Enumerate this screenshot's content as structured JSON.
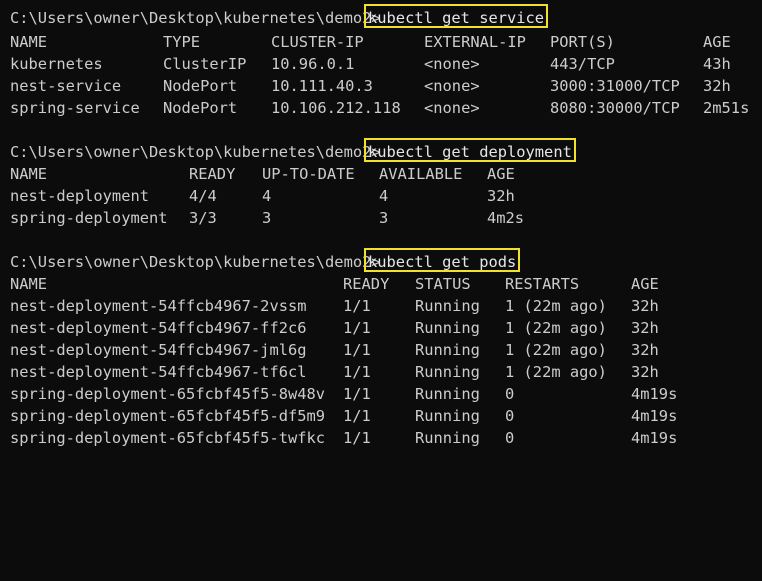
{
  "terminal": {
    "blocks": [
      {
        "prompt": "C:\\Users\\owner\\Desktop\\kubernetes\\demo2>",
        "command": "kubectl get service",
        "headers": [
          "NAME",
          "TYPE",
          "CLUSTER-IP",
          "EXTERNAL-IP",
          "PORT(S)",
          "AGE"
        ],
        "rows": [
          [
            "kubernetes",
            "ClusterIP",
            "10.96.0.1",
            "<none>",
            "443/TCP",
            "43h"
          ],
          [
            "nest-service",
            "NodePort",
            "10.111.40.3",
            "<none>",
            "3000:31000/TCP",
            "32h"
          ],
          [
            "spring-service",
            "NodePort",
            "10.106.212.118",
            "<none>",
            "8080:30000/TCP",
            "2m51s"
          ]
        ]
      },
      {
        "prompt": "C:\\Users\\owner\\Desktop\\kubernetes\\demo2>",
        "command": "kubectl get deployment",
        "headers": [
          "NAME",
          "READY",
          "UP-TO-DATE",
          "AVAILABLE",
          "AGE"
        ],
        "rows": [
          [
            "nest-deployment",
            "4/4",
            "4",
            "4",
            "32h"
          ],
          [
            "spring-deployment",
            "3/3",
            "3",
            "3",
            "4m2s"
          ]
        ]
      },
      {
        "prompt": "C:\\Users\\owner\\Desktop\\kubernetes\\demo2>",
        "command": "kubectl get pods",
        "headers": [
          "NAME",
          "READY",
          "STATUS",
          "RESTARTS",
          "AGE"
        ],
        "rows": [
          [
            "nest-deployment-54ffcb4967-2vssm",
            "1/1",
            "Running",
            "1 (22m ago)",
            "32h"
          ],
          [
            "nest-deployment-54ffcb4967-ff2c6",
            "1/1",
            "Running",
            "1 (22m ago)",
            "32h"
          ],
          [
            "nest-deployment-54ffcb4967-jml6g",
            "1/1",
            "Running",
            "1 (22m ago)",
            "32h"
          ],
          [
            "nest-deployment-54ffcb4967-tf6cl",
            "1/1",
            "Running",
            "1 (22m ago)",
            "32h"
          ],
          [
            "spring-deployment-65fcbf45f5-8w48v",
            "1/1",
            "Running",
            "0",
            "4m19s"
          ],
          [
            "spring-deployment-65fcbf45f5-df5m9",
            "1/1",
            "Running",
            "0",
            "4m19s"
          ],
          [
            "spring-deployment-65fcbf45f5-twfkc",
            "1/1",
            "Running",
            "0",
            "4m19s"
          ]
        ]
      }
    ]
  },
  "colors": {
    "background": "#0c0c0c",
    "text": "#cccccc",
    "highlight_box": "#f2e12a"
  }
}
